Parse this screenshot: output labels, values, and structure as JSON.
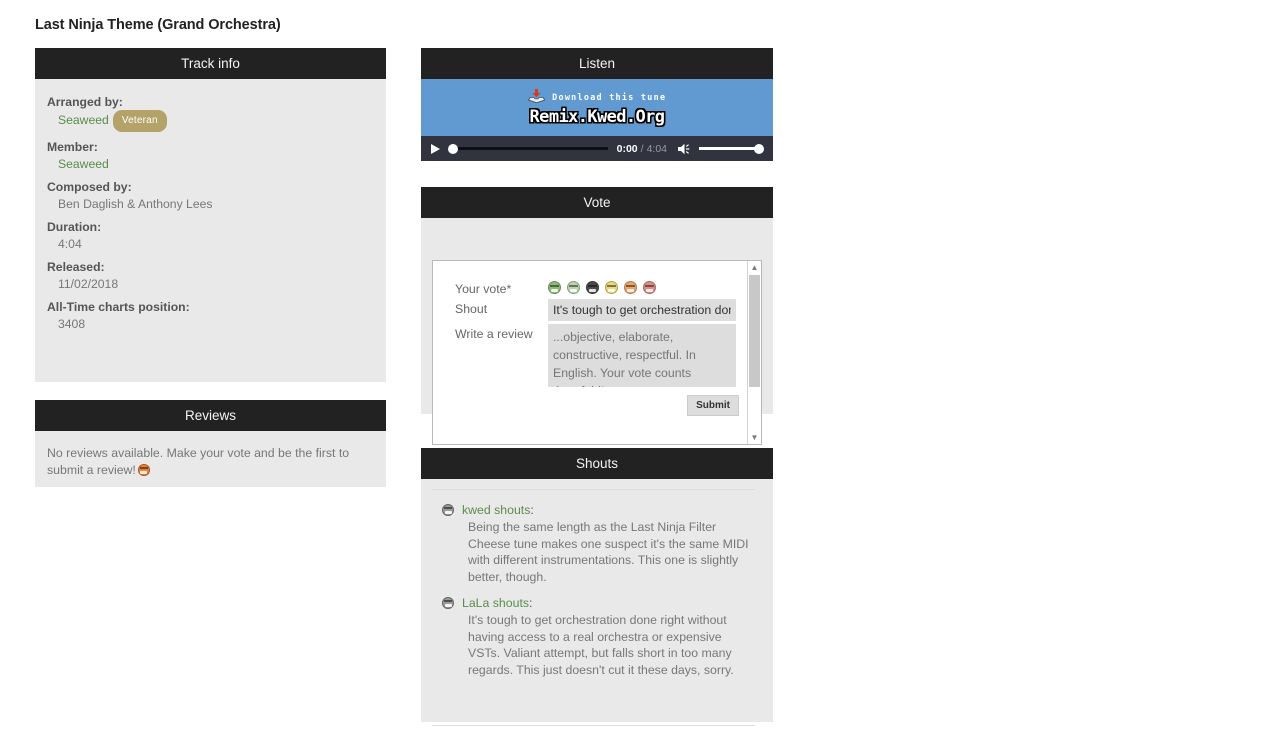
{
  "page": {
    "title": "Last Ninja Theme (Grand Orchestra)"
  },
  "colors": {
    "panel_header_bg": "#222222",
    "panel_body_bg": "#e9e9e9",
    "link_green": "#5a8c4a",
    "badge_tan": "#b3a369",
    "banner_blue": "#619ad1",
    "player_bg": "#31333f"
  },
  "track_info": {
    "header": "Track info",
    "fields": [
      {
        "label": "Arranged by:",
        "value": "Seaweed",
        "is_link": true,
        "badge": "Veteran"
      },
      {
        "label": "Member:",
        "value": "Seaweed",
        "is_link": true,
        "badge": ""
      },
      {
        "label": "Composed by:",
        "value": "Ben Daglish & Anthony Lees",
        "is_link": false,
        "badge": ""
      },
      {
        "label": "Duration:",
        "value": "4:04",
        "is_link": false,
        "badge": ""
      },
      {
        "label": "Released:",
        "value": "11/02/2018",
        "is_link": false,
        "badge": ""
      },
      {
        "label": "All-Time charts position:",
        "value": "3408",
        "is_link": false,
        "badge": ""
      }
    ]
  },
  "reviews": {
    "header": "Reviews",
    "empty_text": "No reviews available. Make your vote and be the first to submit a review!",
    "empty_emoji": "smiley-orange-icon"
  },
  "listen": {
    "header": "Listen",
    "banner": {
      "download_icon": "download-icon",
      "download_text": "Download this tune",
      "logo_text": "Remix.Kwed.Org"
    },
    "player": {
      "play_icon": "play-icon",
      "current_time": "0:00",
      "separator": "/",
      "total_time": "4:04",
      "volume_icon": "speaker-icon",
      "progress_percent": 0,
      "volume_percent": 100
    }
  },
  "vote": {
    "header": "Vote",
    "your_vote_label": "Your vote*",
    "smilies": [
      {
        "name": "vote-smiley-1",
        "color": "#8fb87a"
      },
      {
        "name": "vote-smiley-2",
        "color": "#b8d4a8"
      },
      {
        "name": "vote-smiley-3",
        "color": "#4a4a4a"
      },
      {
        "name": "vote-smiley-4",
        "color": "#ead87a"
      },
      {
        "name": "vote-smiley-5",
        "color": "#e8a567"
      },
      {
        "name": "vote-smiley-6",
        "color": "#dd8c84"
      }
    ],
    "shout_label": "Shout",
    "shout_value": "It's tough to get orchestration don",
    "review_label": "Write a review",
    "review_value": "",
    "review_placeholder": "...objective, elaborate, constructive, respectful. In English. Your vote counts threefold!",
    "submit_label": "Submit",
    "scrollbar": {
      "up_arrow": "chevron-up-icon",
      "down_arrow": "chevron-down-icon"
    }
  },
  "shouts": {
    "header": "Shouts",
    "items": [
      {
        "emoji": "smiley-gray-icon",
        "author": "kwed shouts",
        "colon": ":",
        "text": "Being the same length as the Last Ninja Filter Cheese tune makes one suspect it's the same MIDI with different instrumentations. This one is slightly better, though."
      },
      {
        "emoji": "smiley-gray-icon",
        "author": "LaLa shouts",
        "colon": ":",
        "text": "It's tough to get orchestration done right without having access to a real orchestra or expensive VSTs. Valiant attempt, but falls short in too many regards. This just doesn't cut it these days, sorry."
      }
    ]
  }
}
